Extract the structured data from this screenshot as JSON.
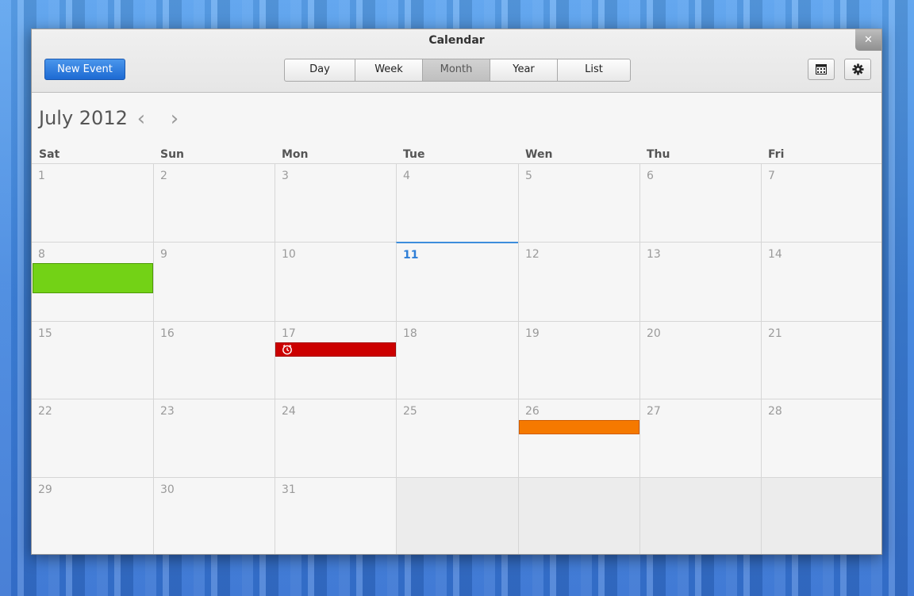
{
  "window": {
    "title": "Calendar",
    "close_glyph": "✕",
    "new_event_label": "New Event"
  },
  "view_switch": [
    {
      "label": "Day",
      "active": false
    },
    {
      "label": "Week",
      "active": false
    },
    {
      "label": "Month",
      "active": true
    },
    {
      "label": "Year",
      "active": false
    },
    {
      "label": "List",
      "active": false
    }
  ],
  "toolbar_icons": [
    "calendar-grid-icon",
    "gear-icon"
  ],
  "month_header": {
    "title": "July 2012",
    "prev_glyph": "‹",
    "next_glyph": "›"
  },
  "weekdays": [
    "Sat",
    "Sun",
    "Mon",
    "Tue",
    "Wen",
    "Thu",
    "Fri"
  ],
  "weeks": [
    [
      "1",
      "2",
      "3",
      "4",
      "5",
      "6",
      "7"
    ],
    [
      "8",
      "9",
      "10",
      "11",
      "12",
      "13",
      "14"
    ],
    [
      "15",
      "16",
      "17",
      "18",
      "19",
      "20",
      "21"
    ],
    [
      "22",
      "23",
      "24",
      "25",
      "26",
      "27",
      "28"
    ],
    [
      "29",
      "30",
      "31",
      "",
      "",
      "",
      ""
    ]
  ],
  "today": "11",
  "events": [
    {
      "day": "8",
      "color": "#73d216",
      "border": "#4e9a06",
      "style": "tall",
      "has_alarm": false
    },
    {
      "day": "17",
      "color": "#cc0000",
      "border": "#a40000",
      "style": "bar",
      "has_alarm": true
    },
    {
      "day": "26",
      "color": "#f57900",
      "border": "#ce5c00",
      "style": "bar",
      "has_alarm": false
    }
  ],
  "colors": {
    "accent": "#1d6ad3",
    "today": "#2f7fd7"
  }
}
